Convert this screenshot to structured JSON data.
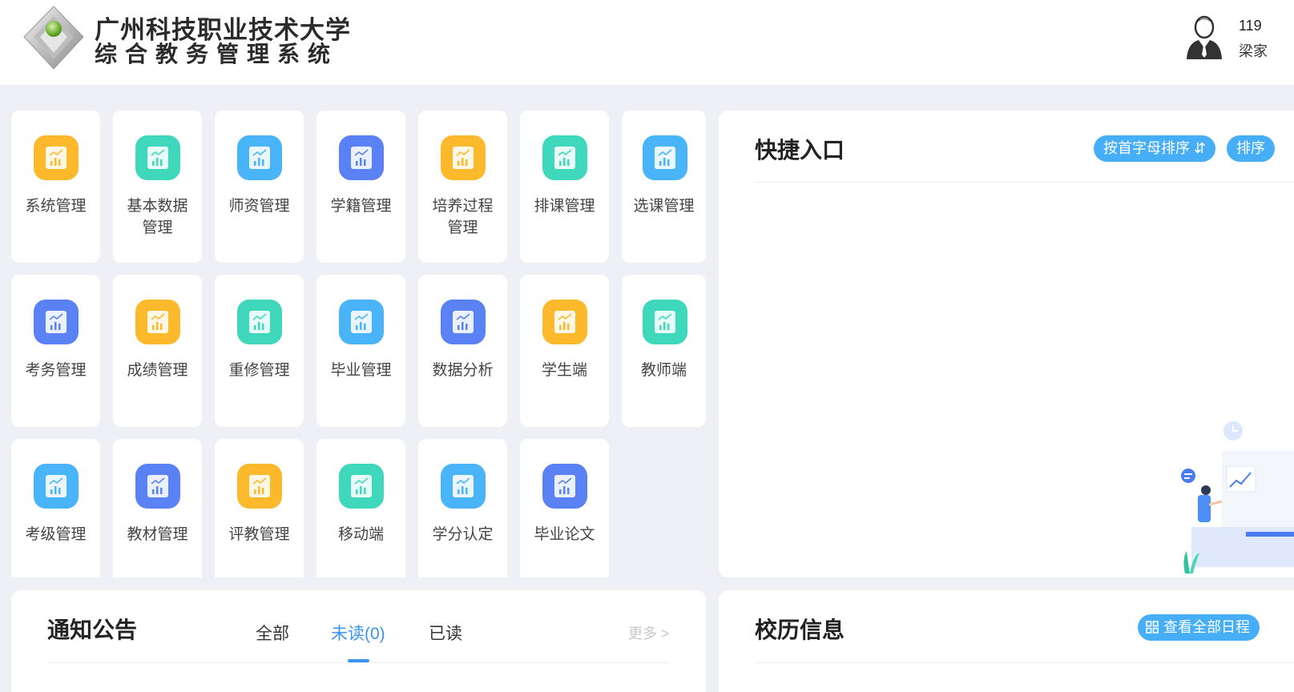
{
  "header": {
    "school_name": "广州科技职业技术大学",
    "system_name": "综合教务管理系统",
    "user_id": "119",
    "user_name": "梁家"
  },
  "modules": [
    {
      "label": "系统管理",
      "color": "#fcb92c"
    },
    {
      "label": "基本数据管理",
      "color": "#3fd8bd"
    },
    {
      "label": "师资管理",
      "color": "#4ab4f8"
    },
    {
      "label": "学籍管理",
      "color": "#5a82f5"
    },
    {
      "label": "培养过程管理",
      "color": "#fcb92c"
    },
    {
      "label": "排课管理",
      "color": "#3fd8bd"
    },
    {
      "label": "选课管理",
      "color": "#4ab4f8"
    },
    {
      "label": "考务管理",
      "color": "#5a82f5"
    },
    {
      "label": "成绩管理",
      "color": "#fcb92c"
    },
    {
      "label": "重修管理",
      "color": "#3fd8bd"
    },
    {
      "label": "毕业管理",
      "color": "#4ab4f8"
    },
    {
      "label": "数据分析",
      "color": "#5a82f5"
    },
    {
      "label": "学生端",
      "color": "#fcb92c"
    },
    {
      "label": "教师端",
      "color": "#3fd8bd"
    },
    {
      "label": "考级管理",
      "color": "#4ab4f8"
    },
    {
      "label": "教材管理",
      "color": "#5a82f5"
    },
    {
      "label": "评教管理",
      "color": "#fcb92c"
    },
    {
      "label": "移动端",
      "color": "#3fd8bd"
    },
    {
      "label": "学分认定",
      "color": "#4ab4f8"
    },
    {
      "label": "毕业论文",
      "color": "#5a82f5"
    }
  ],
  "quick_access": {
    "title": "快捷入口",
    "sort_alpha_label": "按首字母排序 ⇵",
    "sort_second_label": "排序"
  },
  "notice": {
    "title": "通知公告",
    "tabs": [
      "全部",
      "未读(0)",
      "已读"
    ],
    "active_tab": "未读(0)",
    "more_label": "更多 >"
  },
  "calendar": {
    "title": "校历信息",
    "view_all_label": "查看全部日程"
  },
  "colors": {
    "accent": "#3a93f0",
    "pill": "#46aef7",
    "background": "#eef0f5"
  }
}
